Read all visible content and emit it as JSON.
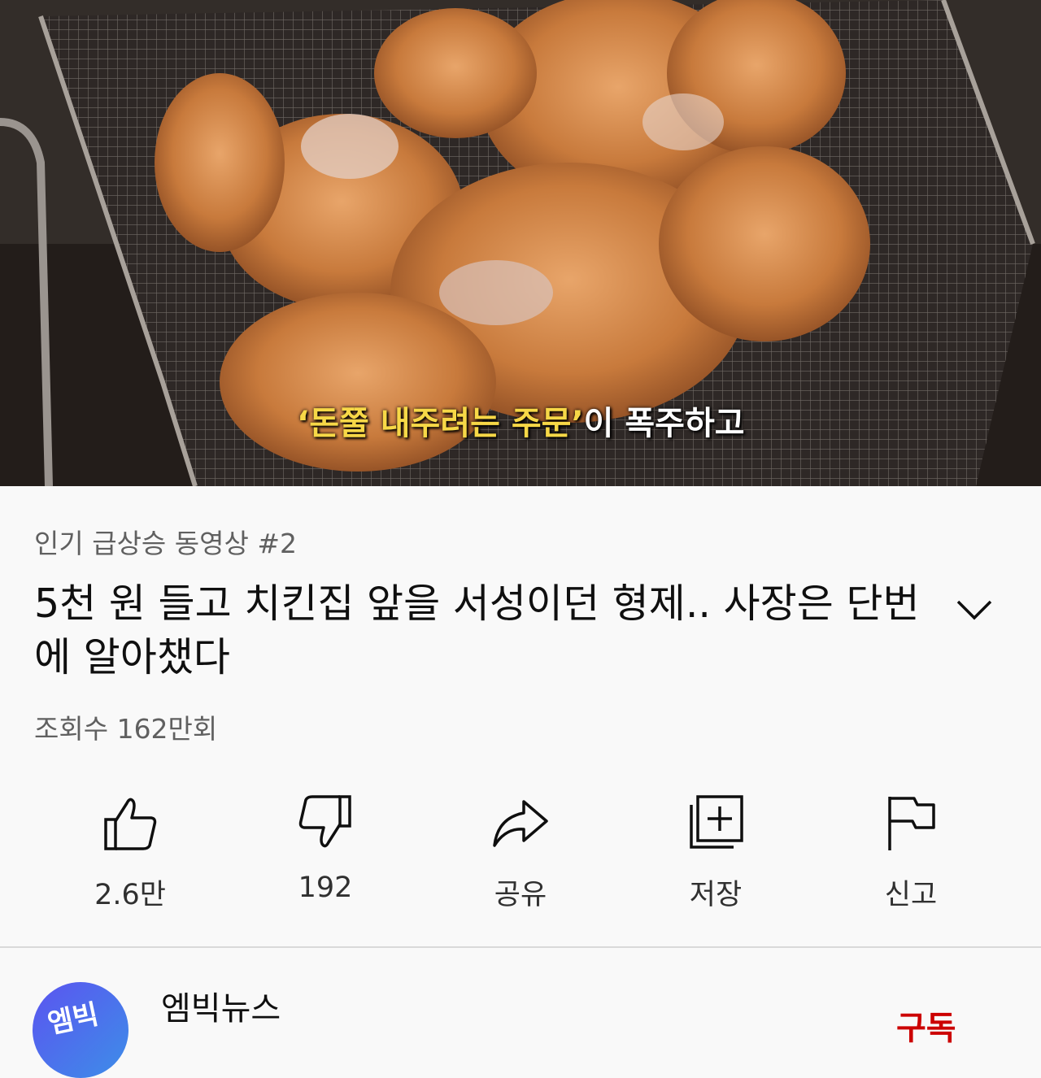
{
  "video": {
    "caption_highlight": "‘돈쭐 내주려는 주문’",
    "caption_rest": "이 폭주하고"
  },
  "info": {
    "trending": "인기 급상승 동영상 #2",
    "title": "5천 원 들고 치킨집 앞을 서성이던 형제.. 사장은 단번에 알아챘다",
    "views": "조회수 162만회"
  },
  "actions": {
    "like": "2.6만",
    "dislike": "192",
    "share": "공유",
    "save": "저장",
    "report": "신고"
  },
  "channel": {
    "avatar_text": "엠빅",
    "name": "엠빅뉴스",
    "subscribe": "구독"
  },
  "colors": {
    "subscribe": "#cc0000",
    "background": "#f9f9f9",
    "secondary_text": "#606060"
  }
}
